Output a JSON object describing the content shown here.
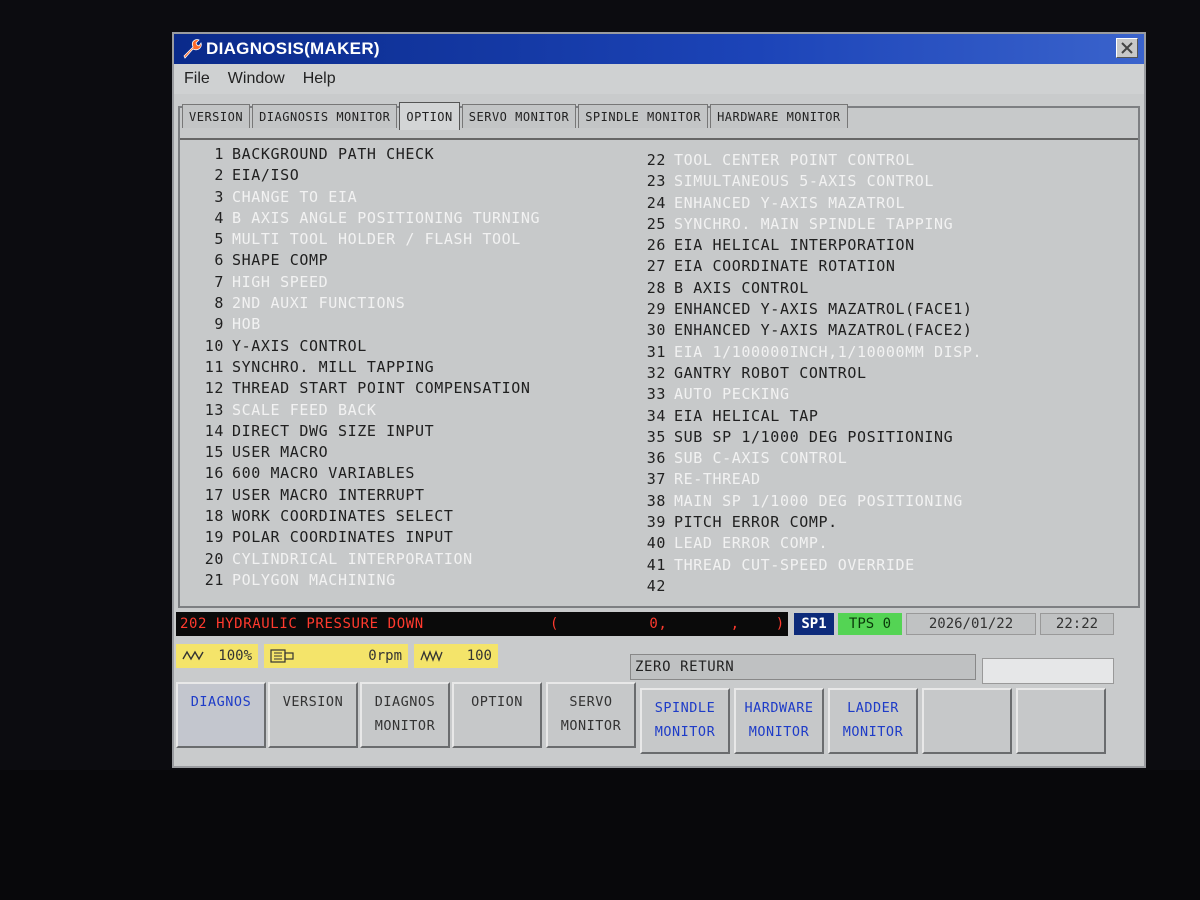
{
  "window": {
    "title": "DIAGNOSIS(MAKER)"
  },
  "menu": [
    "File",
    "Window",
    "Help"
  ],
  "tabs": [
    "VERSION",
    "DIAGNOSIS MONITOR",
    "OPTION",
    "SERVO MONITOR",
    "SPINDLE MONITOR",
    "HARDWARE MONITOR"
  ],
  "active_tab": "OPTION",
  "options_left": [
    {
      "num": "1",
      "name": "BACKGROUND PATH CHECK",
      "enabled": true
    },
    {
      "num": "2",
      "name": "EIA/ISO",
      "enabled": true
    },
    {
      "num": "3",
      "name": "CHANGE TO EIA",
      "enabled": false
    },
    {
      "num": "4",
      "name": "B AXIS ANGLE POSITIONING TURNING",
      "enabled": false
    },
    {
      "num": "5",
      "name": "MULTI TOOL HOLDER / FLASH TOOL",
      "enabled": false
    },
    {
      "num": "6",
      "name": "SHAPE COMP",
      "enabled": true
    },
    {
      "num": "7",
      "name": "HIGH SPEED",
      "enabled": false
    },
    {
      "num": "8",
      "name": "2ND AUXI FUNCTIONS",
      "enabled": false
    },
    {
      "num": "9",
      "name": "HOB",
      "enabled": false
    },
    {
      "num": "10",
      "name": "Y-AXIS CONTROL",
      "enabled": true
    },
    {
      "num": "11",
      "name": "SYNCHRO. MILL TAPPING",
      "enabled": true
    },
    {
      "num": "12",
      "name": "THREAD START POINT COMPENSATION",
      "enabled": true
    },
    {
      "num": "13",
      "name": "SCALE FEED BACK",
      "enabled": false
    },
    {
      "num": "14",
      "name": "DIRECT DWG SIZE INPUT",
      "enabled": true
    },
    {
      "num": "15",
      "name": "USER MACRO",
      "enabled": true
    },
    {
      "num": "16",
      "name": "600 MACRO VARIABLES",
      "enabled": true
    },
    {
      "num": "17",
      "name": "USER MACRO INTERRUPT",
      "enabled": true
    },
    {
      "num": "18",
      "name": "WORK COORDINATES SELECT",
      "enabled": true
    },
    {
      "num": "19",
      "name": "POLAR COORDINATES INPUT",
      "enabled": true
    },
    {
      "num": "20",
      "name": "CYLINDRICAL INTERPORATION",
      "enabled": false
    },
    {
      "num": "21",
      "name": "POLYGON MACHINING",
      "enabled": false
    }
  ],
  "options_right": [
    {
      "num": "22",
      "name": "TOOL CENTER POINT CONTROL",
      "enabled": false
    },
    {
      "num": "23",
      "name": "SIMULTANEOUS 5-AXIS CONTROL",
      "enabled": false
    },
    {
      "num": "24",
      "name": "ENHANCED Y-AXIS MAZATROL",
      "enabled": false
    },
    {
      "num": "25",
      "name": "SYNCHRO. MAIN SPINDLE TAPPING",
      "enabled": false
    },
    {
      "num": "26",
      "name": "EIA HELICAL INTERPORATION",
      "enabled": true
    },
    {
      "num": "27",
      "name": "EIA COORDINATE ROTATION",
      "enabled": true
    },
    {
      "num": "28",
      "name": "B AXIS CONTROL",
      "enabled": true
    },
    {
      "num": "29",
      "name": "ENHANCED Y-AXIS MAZATROL(FACE1)",
      "enabled": true
    },
    {
      "num": "30",
      "name": "ENHANCED Y-AXIS MAZATROL(FACE2)",
      "enabled": true
    },
    {
      "num": "31",
      "name": "EIA 1/100000INCH,1/10000MM DISP.",
      "enabled": false
    },
    {
      "num": "32",
      "name": "GANTRY ROBOT CONTROL",
      "enabled": true
    },
    {
      "num": "33",
      "name": "AUTO PECKING",
      "enabled": false
    },
    {
      "num": "34",
      "name": "EIA HELICAL TAP",
      "enabled": true
    },
    {
      "num": "35",
      "name": "SUB SP 1/1000 DEG POSITIONING",
      "enabled": true
    },
    {
      "num": "36",
      "name": "SUB C-AXIS CONTROL",
      "enabled": false
    },
    {
      "num": "37",
      "name": "RE-THREAD",
      "enabled": false
    },
    {
      "num": "38",
      "name": "MAIN SP 1/1000 DEG POSITIONING",
      "enabled": false
    },
    {
      "num": "39",
      "name": "PITCH ERROR COMP.",
      "enabled": true
    },
    {
      "num": "40",
      "name": "LEAD ERROR COMP.",
      "enabled": false
    },
    {
      "num": "41",
      "name": "THREAD CUT-SPEED OVERRIDE",
      "enabled": false
    },
    {
      "num": "42",
      "name": "",
      "enabled": true
    }
  ],
  "status": {
    "alarm": "202 HYDRAULIC PRESSURE DOWN",
    "alarm_coords": "(          0,       ,    )",
    "spindle_tag": "SP1",
    "tps": "TPS 0",
    "date": "2026/01/22",
    "time": "22:22",
    "feed_override": "100%",
    "spindle_speed": "0rpm",
    "rapid_override": "100",
    "mode": "ZERO RETURN"
  },
  "softkeys": [
    {
      "l1": "DIAGNOS",
      "l2": "",
      "blue": true
    },
    {
      "l1": "VERSION",
      "l2": "",
      "blue": false
    },
    {
      "l1": "DIAGNOS",
      "l2": "MONITOR",
      "blue": false
    },
    {
      "l1": "OPTION",
      "l2": "",
      "blue": false
    },
    {
      "l1": "SERVO",
      "l2": "MONITOR",
      "blue": false
    },
    {
      "l1": "SPINDLE",
      "l2": "MONITOR",
      "blue": true
    },
    {
      "l1": "HARDWARE",
      "l2": "MONITOR",
      "blue": true
    },
    {
      "l1": "LADDER",
      "l2": "MONITOR",
      "blue": true
    },
    {
      "l1": "",
      "l2": "",
      "blue": false
    },
    {
      "l1": "",
      "l2": "",
      "blue": false
    }
  ],
  "colors": {
    "titlebar": "#1c44b8",
    "alarm_text": "#ff3a2e",
    "tps_bg": "#54d454",
    "gauge_bg": "#f4e46a",
    "softkey_blue_text": "#1e3cc8"
  }
}
